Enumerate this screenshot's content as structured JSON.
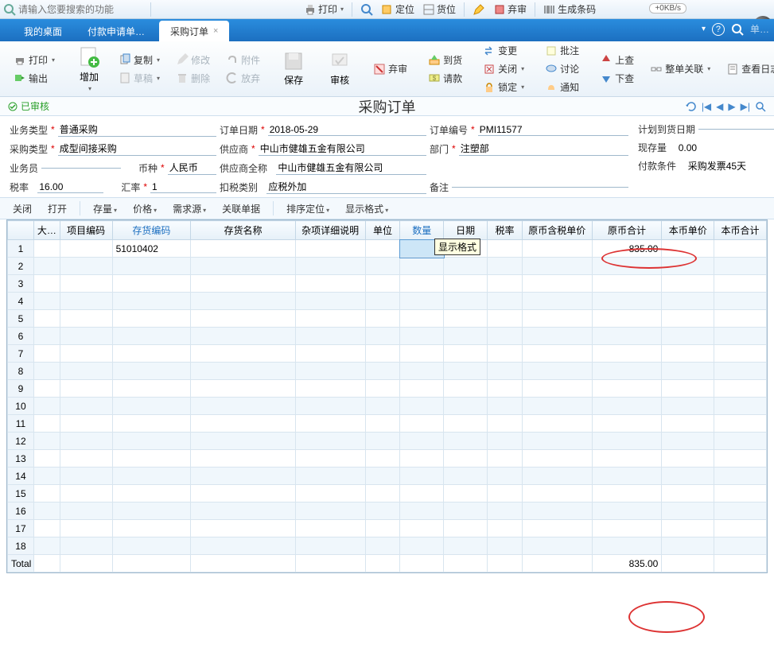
{
  "sys": {
    "search_placeholder": "请输入您要搜索的功能",
    "print": "打印",
    "locate": "定位",
    "goods": "货位",
    "discard": "弃审",
    "barcode": "生成条码",
    "speed": "+0KB/s"
  },
  "tabs": {
    "desktop": "我的桌面",
    "payreq": "付款申请单…",
    "po": "采购订单",
    "search_hint": "单…"
  },
  "ribbon": {
    "print": "打印",
    "output": "输出",
    "add": "增加",
    "copy": "复制",
    "modify": "修改",
    "attach": "附件",
    "draft": "草稿",
    "delete": "删除",
    "release": "放弃",
    "save": "保存",
    "audit": "审核",
    "discard": "弃审",
    "arrive": "到货",
    "request": "请款",
    "change": "变更",
    "close": "关闭",
    "lock": "锁定",
    "approve": "批注",
    "discuss": "讨论",
    "notify": "通知",
    "up": "上查",
    "down": "下查",
    "wholeLink": "整单关联",
    "viewLog": "查看日志"
  },
  "status": {
    "approved": "已审核",
    "title": "采购订单"
  },
  "form": {
    "bizTypeLbl": "业务类型",
    "bizType": "普通采购",
    "purTypeLbl": "采购类型",
    "purType": "成型间接采购",
    "salesmanLbl": "业务员",
    "taxRateLbl": "税率",
    "taxRate": "16.00",
    "exRateLbl": "汇率",
    "exRate": "1",
    "currencyLbl": "币种",
    "currency": "人民币",
    "orderDateLbl": "订单日期",
    "orderDate": "2018-05-29",
    "supplierLbl": "供应商",
    "supplier": "中山市健雄五金有限公司",
    "supplierFullLbl": "供应商全称",
    "supplierFull": "中山市健雄五金有限公司",
    "taxCatLbl": "扣税类别",
    "taxCat": "应税外加",
    "orderNoLbl": "订单编号",
    "orderNo": "PMI11577",
    "deptLbl": "部门",
    "dept": "注塑部",
    "remarkLbl": "备注",
    "planDateLbl": "计划到货日期",
    "stockLbl": "现存量",
    "stock": "0.00",
    "payTermLbl": "付款条件",
    "payTerm": "采购发票45天"
  },
  "sub": {
    "close": "关闭",
    "open": "打开",
    "stock": "存量",
    "price": "价格",
    "demand": "需求源",
    "link": "关联单据",
    "sort": "排序定位",
    "disp": "显示格式"
  },
  "grid": {
    "headers": {
      "row": "",
      "big": "大…",
      "proj": "项目编码",
      "inv": "存货编码",
      "name": "存货名称",
      "misc": "杂项详细说明",
      "unit": "单位",
      "qty": "数量",
      "wh": "日期",
      "tax2": "税率",
      "origTaxPrice": "原币含税单价",
      "origTotal": "原币合计",
      "localPrice": "本币单价",
      "localTotal": "本币合计"
    },
    "tooltip": "显示格式",
    "rows": [
      {
        "inv": "51010402",
        "origTotal": "835.00"
      }
    ],
    "totalLabel": "Total",
    "totalOrig": "835.00"
  }
}
